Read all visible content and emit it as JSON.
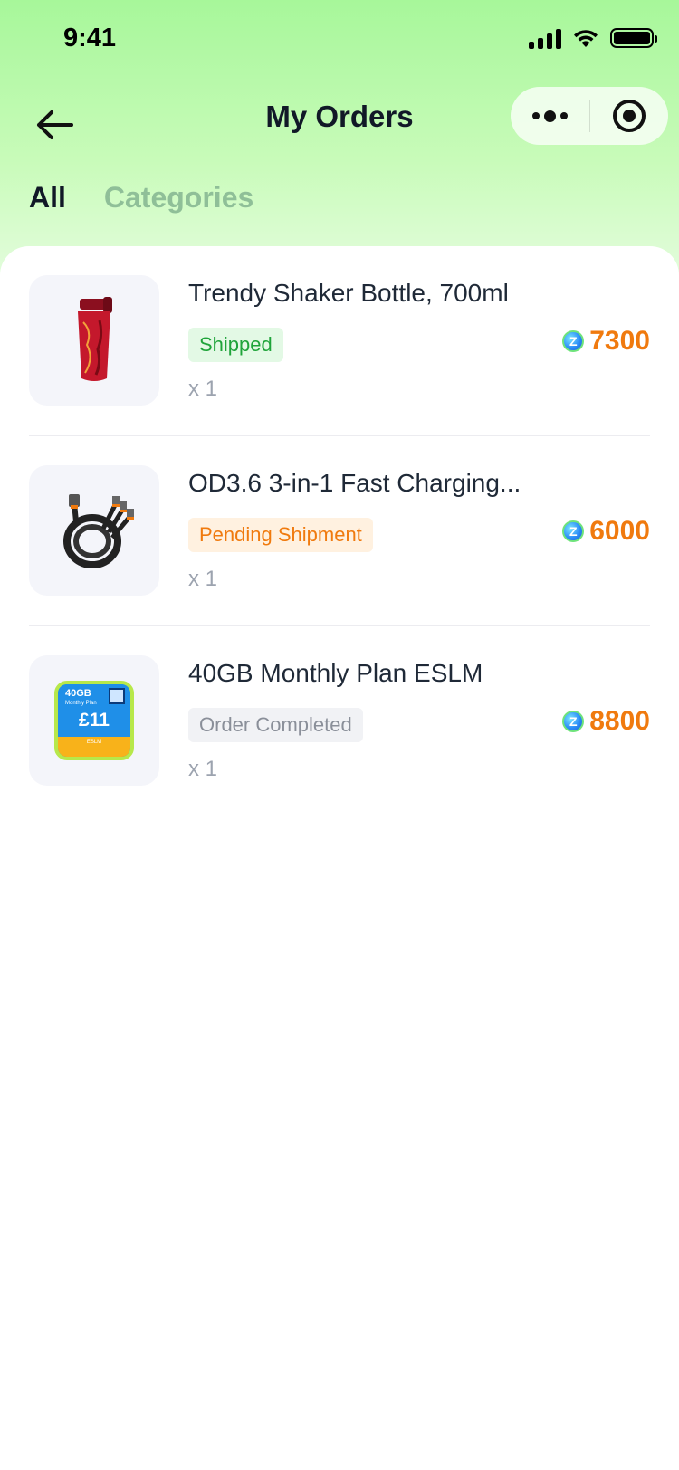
{
  "status_bar": {
    "time": "9:41"
  },
  "header": {
    "title": "My Orders"
  },
  "tabs": [
    {
      "label": "All",
      "active": true
    },
    {
      "label": "Categories",
      "active": false
    }
  ],
  "orders": [
    {
      "name": "Trendy Shaker Bottle, 700ml",
      "status": "Shipped",
      "status_color": "#1fa43a",
      "quantity": "x 1",
      "price": "7300",
      "image": "red-shaker-bottle"
    },
    {
      "name": "OD3.6 3-in-1 Fast Charging...",
      "status": "Pending Shipment",
      "status_color": "#f07a0e",
      "quantity": "x 1",
      "price": "6000",
      "image": "black-charging-cable"
    },
    {
      "name": "40GB Monthly Plan ESLM",
      "status": "Order Completed",
      "status_color": "#8a8f99",
      "quantity": "x 1",
      "price": "8800",
      "image": "data-plan-card",
      "plan": {
        "gb": "40GB",
        "sub": "Monthly Plan",
        "price": "£11",
        "brand": "ESLM"
      }
    }
  ],
  "colors": {
    "accent": "#f07a0e",
    "header_green": "#a7f79a"
  }
}
